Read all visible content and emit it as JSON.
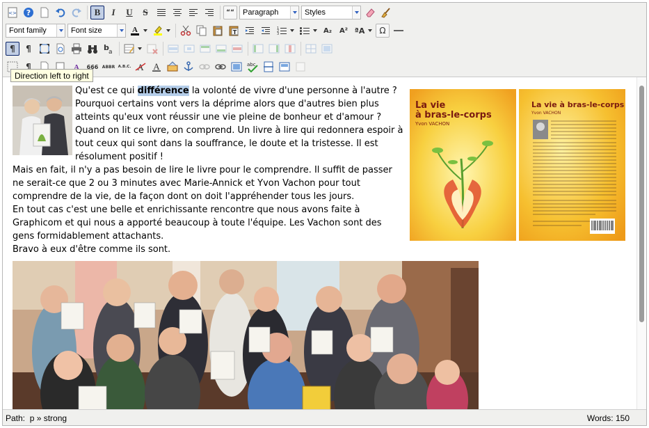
{
  "toolbar": {
    "format_select": "Paragraph",
    "styles_select": "Styles",
    "font_family_select": "Font family",
    "font_size_select": "Font size",
    "bold_label": "B",
    "italic_label": "I",
    "underline_label": "U",
    "strike_label": "S",
    "blockquote_label": "““",
    "superscript_label": "A₂",
    "subscript_label": "A²",
    "case_label": "ªA",
    "omega_label": "Ω",
    "ltr_label": "¶",
    "rtl_label": "¶",
    "quote_label": "666",
    "abbr_label": "ABBR",
    "acronym_label": "A.B.C.",
    "abc_label": "abc"
  },
  "tooltip": "Direction left to right",
  "content": {
    "selected_word": "différence",
    "para1_before": "Qu'est ce qui ",
    "para1_after": " la volonté de vivre d'une personne à l'autre ? Pourquoi certains vont vers la déprime alors que d'autres bien plus atteints qu'eux vont réussir une vie pleine de bonheur et d'amour ? Quand on lit ce livre, on comprend. Un livre à lire qui redonnera espoir à tout ceux qui sont dans la souffrance, le doute et la tristesse. Il est résolument positif !",
    "para2": "Mais en fait, il n'y a pas besoin de lire le livre pour le comprendre. Il suffit de passer ne serait-ce que 2 ou 3 minutes avec Marie-Annick et Yvon Vachon pour tout comprendre de la vie, de la façon dont on doit l'appréhender tous les jours.",
    "para3": "En tout cas c'est une belle et enrichissante rencontre que nous avons faite à Graphicom et qui nous a apporté beaucoup à toute l'équipe. Les Vachon sont des gens formidablement attachants.",
    "para4": "Bravo à eux d'être comme ils sont.",
    "book_front_title": "La vie à bras-le-corps",
    "book_front_author": "Yvon VACHON",
    "book_back_title": "La vie à bras-le-corps",
    "book_back_author": "Yvon VACHON"
  },
  "status": {
    "path_label": "Path:",
    "path_value": "p » strong",
    "words": "Words: 150"
  }
}
